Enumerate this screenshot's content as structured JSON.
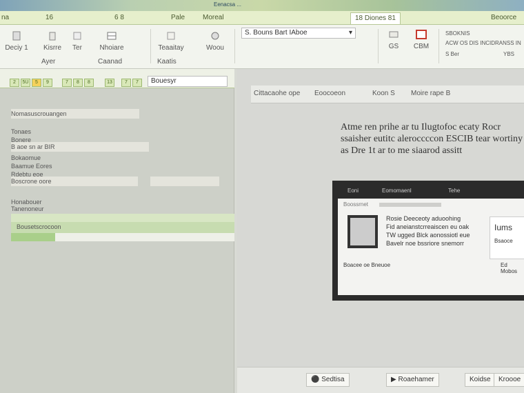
{
  "tabbar": {
    "tabs": [
      "na",
      "16",
      "6 8",
      "Pale",
      "Moreal",
      "18 Diones 81"
    ],
    "right_label": "Beoorce"
  },
  "topstrip": {
    "title": "Eenacsa ..."
  },
  "ribbon": {
    "buttons": [
      {
        "label": "Deciy 1",
        "icon": "paste-icon"
      },
      {
        "label": "Kisrre",
        "icon": "clipboard-icon"
      },
      {
        "label": "Ter",
        "icon": "format-icon"
      },
      {
        "label": "Nhoiare",
        "icon": "table-icon"
      },
      {
        "label": "Teaaitay",
        "icon": "style-icon"
      },
      {
        "label": "Woou",
        "icon": "gear-icon"
      }
    ],
    "sub_labels": [
      "Ayer",
      "Caanad",
      "Kaatis"
    ],
    "dropdown_value": "S. Bouns Bart IAboe",
    "right_items": [
      "GS",
      "CBM"
    ],
    "right_text": [
      "SBOKNIS",
      "ACW OS DIS INCIDRANSS IN",
      "S Ber",
      "YBS"
    ]
  },
  "left": {
    "toolbar_input": "Bouesyr",
    "cells": [
      "2",
      "5U",
      "5",
      "9",
      "7",
      "8",
      "8",
      "13",
      "7",
      "7"
    ],
    "rows": [
      "Nomasuscrouangen",
      "Tonaes",
      "Bonere",
      "B aoe sn ar BIR",
      "Bokaomue",
      "Baamue Eores",
      "Rdebtu eoe",
      "Boscrone oore",
      "Honabouer",
      "Tanenoneur",
      "Bousetscrocoon"
    ]
  },
  "right": {
    "tabs": [
      "Cittacaohe ope",
      "Eoocoeon",
      "Koon S",
      "Moire rape B"
    ],
    "paragraph": "Atme ren prihe ar tu Ilugtofoc ecaty Rocr ssaisher eutitc aleroccccon ESCIB tear wortiny as Dre 1t ar to me siaarod assitt",
    "embedded": {
      "title_items": [
        "Eoni",
        "Eomomaenl",
        "Tehe"
      ],
      "line1": "Boossrnet",
      "body": [
        "Rosie Deeceoty aduoohing",
        "Fid aneianstcrreaiscen eu oak",
        "TW ugged Blck aonossiotl eue",
        "Bavelr noe bssriore snemorr"
      ],
      "right_box": [
        "Iums",
        "Bsaoce"
      ],
      "footer": [
        "Boacee oe Bneuoe",
        "Ed Mobos"
      ]
    },
    "status_buttons": [
      "Sedtisa",
      "Roaehamer",
      "Koidse",
      "Kroooe"
    ]
  },
  "colors": {
    "accent": "#c63a2d",
    "green": "#9cb870"
  }
}
